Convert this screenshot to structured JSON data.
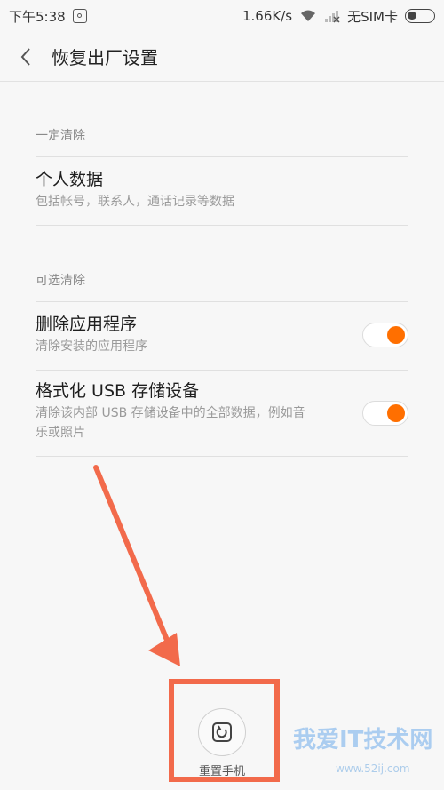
{
  "status_bar": {
    "time": "下午5:38",
    "speed": "1.66K/s",
    "sim": "无SIM卡"
  },
  "header": {
    "title": "恢复出厂设置"
  },
  "sections": {
    "required": {
      "header": "一定清除",
      "items": [
        {
          "title": "个人数据",
          "subtitle": "包括帐号，联系人，通话记录等数据"
        }
      ]
    },
    "optional": {
      "header": "可选清除",
      "items": [
        {
          "title": "删除应用程序",
          "subtitle": "清除安装的应用程序",
          "enabled": true
        },
        {
          "title": "格式化 USB 存储设备",
          "subtitle": "清除该内部 USB 存储设备中的全部数据，例如音乐或照片",
          "enabled": true
        }
      ]
    }
  },
  "reset_button": {
    "label": "重置手机"
  },
  "watermark": {
    "text": "我爱IT技术网",
    "sub": "www.52ij.com"
  },
  "colors": {
    "accent": "#ff6f00",
    "annotation": "#f26a4b"
  }
}
